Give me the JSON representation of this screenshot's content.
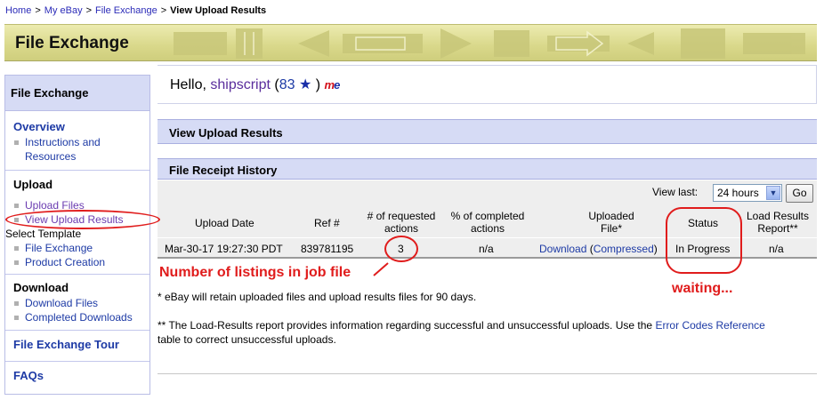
{
  "breadcrumb": {
    "items": [
      "Home",
      "My eBay",
      "File Exchange"
    ],
    "current": "View Upload Results",
    "separator": ">"
  },
  "banner": {
    "title": "File Exchange"
  },
  "sidebar": {
    "header": "File Exchange",
    "overview": {
      "heading": "Overview",
      "items": [
        "Instructions and Resources"
      ]
    },
    "upload": {
      "heading": "Upload",
      "items": [
        "Upload Files",
        "View Upload Results"
      ],
      "select_template": "Select Template",
      "template_items": [
        "File Exchange",
        "Product Creation"
      ]
    },
    "download": {
      "heading": "Download",
      "items": [
        "Download Files",
        "Completed Downloads"
      ]
    },
    "tour": "File Exchange Tour",
    "faqs": "FAQs"
  },
  "hello": {
    "prefix": "Hello,",
    "username": "shipscript",
    "open": "(",
    "score": "83",
    "close": ")",
    "logo_m": "m",
    "logo_e": "e"
  },
  "page_title": "View Upload Results",
  "receipt": {
    "title": "File Receipt History",
    "view_last_label": "View last:",
    "view_last_value": "24 hours",
    "go_label": "Go",
    "columns": {
      "upload_date": "Upload Date",
      "ref": "Ref #",
      "requested_1": "# of requested",
      "requested_2": "actions",
      "completed_1": "% of completed",
      "completed_2": "actions",
      "uploaded_1": "Uploaded",
      "uploaded_2": "File*",
      "status": "Status",
      "report_1": "Load Results",
      "report_2": "Report**"
    },
    "row": {
      "upload_date": "Mar-30-17 19:27:30 PDT",
      "ref": "839781195",
      "requested": "3",
      "completed": "n/a",
      "download": "Download",
      "compressed_open": "(",
      "compressed": "Compressed",
      "compressed_close": ")",
      "status": "In Progress",
      "report": "n/a"
    }
  },
  "notes": {
    "retention": "* eBay will retain uploaded files and upload results files for 90 days.",
    "load_results_1": "** The Load-Results report provides information regarding successful and unsuccessful uploads. Use the",
    "error_codes_link": "Error Codes Reference",
    "load_results_2": "table to correct unsuccessful uploads."
  },
  "annotations": {
    "listings": "Number of listings in job file",
    "waiting": "waiting..."
  },
  "colors": {
    "link": "#1d3aa5",
    "visited": "#6a3bb0",
    "annotation": "#e01c1c",
    "bar": "#d6dbf5",
    "banner": "#d9d88a"
  }
}
